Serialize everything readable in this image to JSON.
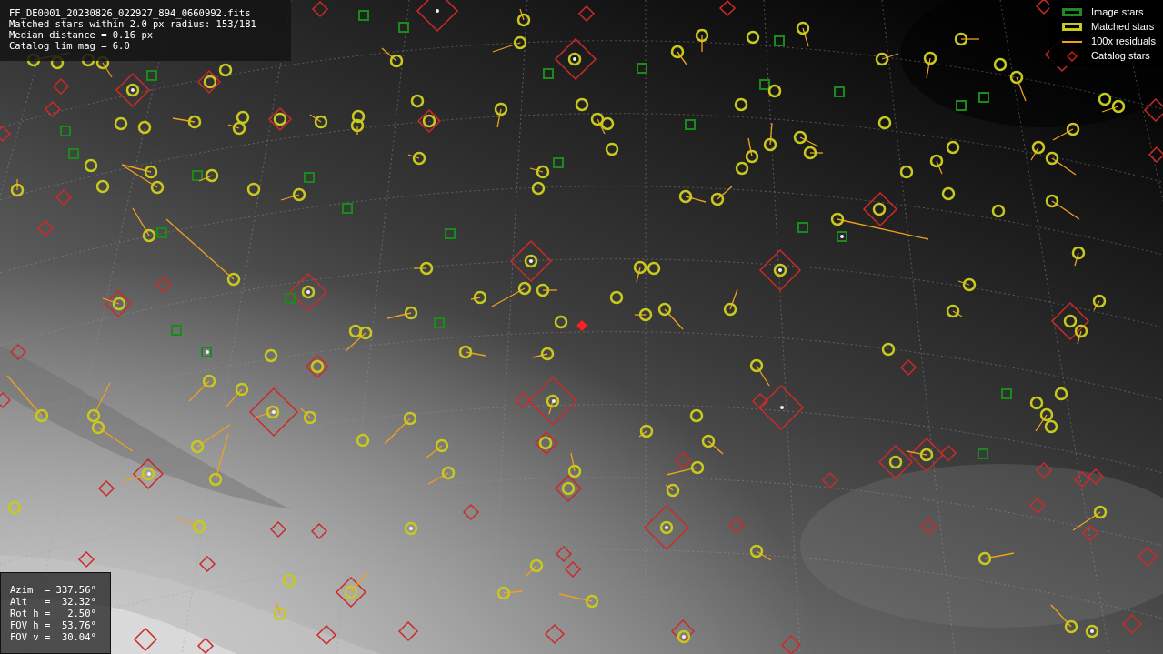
{
  "info": {
    "lines": [
      "FF_DE0001_20230826_022927_894_0660992.fits",
      "Matched stars within 2.0 px radius: 153/181",
      "Median distance = 0.16 px",
      "Catalog lim mag = 6.0"
    ]
  },
  "legend": [
    {
      "kind": "image",
      "label": "Image stars",
      "color": "#1f8a1f"
    },
    {
      "kind": "matched",
      "label": "Matched stars",
      "color": "#c8c81e"
    },
    {
      "kind": "residual",
      "label": "100x residuals",
      "color": "#f0a020"
    },
    {
      "kind": "catalog",
      "label": "Catalog stars",
      "color": "#c81e1e"
    }
  ],
  "pointing": {
    "lines": [
      "Azim  = 337.56°",
      "Alt   =  32.32°",
      "Rot h =   2.50°",
      "FOV h =  53.76°",
      "FOV v =  30.04°"
    ]
  }
}
